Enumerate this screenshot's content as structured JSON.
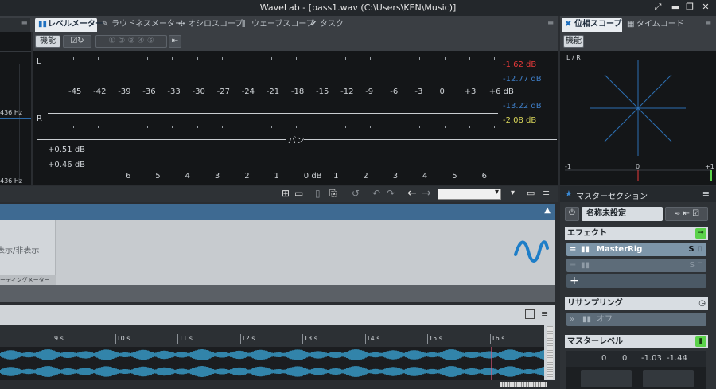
{
  "window": {
    "title": "WaveLab - [bass1.wav (C:\\Users\\KEN\\Music)]"
  },
  "tabs_top": [
    {
      "label": "レベルメーター",
      "icon": "bar-meter-icon",
      "active": true
    },
    {
      "label": "ラウドネスメーター",
      "icon": "pen-icon",
      "active": false
    },
    {
      "label": "オシロスコープ",
      "icon": "cross-dots-icon",
      "active": false
    },
    {
      "label": "ウェーブスコープ",
      "icon": "wavescope-icon",
      "active": false
    },
    {
      "label": "タスク",
      "icon": "check-icon",
      "active": false
    }
  ],
  "tabs_right": [
    {
      "label": "位相スコープ",
      "icon": "phase-icon",
      "active": true
    },
    {
      "label": "タイムコード",
      "icon": "timecode-icon",
      "active": false
    }
  ],
  "meter_toolbar": {
    "func_label": "機能",
    "slots": [
      "①",
      "②",
      "③",
      "④",
      "⑤"
    ]
  },
  "level_meter": {
    "channel_l": "L",
    "channel_r": "R",
    "scale": [
      "-45",
      "-42",
      "-39",
      "-36",
      "-33",
      "-30",
      "-27",
      "-24",
      "-21",
      "-18",
      "-15",
      "-12",
      "-9",
      "-6",
      "-3",
      "0",
      "+3",
      "+6 dB"
    ],
    "peak_l": "-1.62 dB",
    "rms_l": "-12.77 dB",
    "rms_r": "-13.22 dB",
    "peak_r": "-2.08 dB",
    "pan_label": "パン",
    "pan_value_1": "+0.51 dB",
    "pan_value_2": "+0.46 dB",
    "pan_scale": [
      "6",
      "5",
      "4",
      "3",
      "2",
      "1",
      "0 dB",
      "1",
      "2",
      "3",
      "4",
      "5",
      "6"
    ]
  },
  "left_partial": {
    "hz_1": "436 Hz",
    "hz_2": "436 Hz"
  },
  "phase_scope": {
    "func_label": "機能",
    "lr_label": "L / R",
    "scale_min": "-1",
    "scale_mid": "0",
    "scale_max": "+1"
  },
  "middle": {
    "show_hide": "表示/非表示",
    "metering_label": "ーティングメーター"
  },
  "timeline": {
    "marks": [
      "9 s",
      "10 s",
      "11 s",
      "12 s",
      "13 s",
      "14 s",
      "15 s",
      "16 s"
    ]
  },
  "master_section": {
    "title": "マスターセクション",
    "preset_name": "名称未設定",
    "effects_label": "エフェクト",
    "effect_slot_1": "MasterRig",
    "resampling_label": "リサンプリング",
    "resampling_value": "オフ",
    "master_level_label": "マスターレベル",
    "level_values": [
      "0",
      "0",
      "-1.03",
      "-1.44"
    ]
  },
  "colors": {
    "peak_red": "#e83a3a",
    "rms_blue": "#3f7fc8",
    "peak_yellow": "#d9d65a",
    "wave_blue": "#3aa7d8",
    "green_toggle": "#5bd24a",
    "active_tab_bg": "#e9edf1"
  }
}
